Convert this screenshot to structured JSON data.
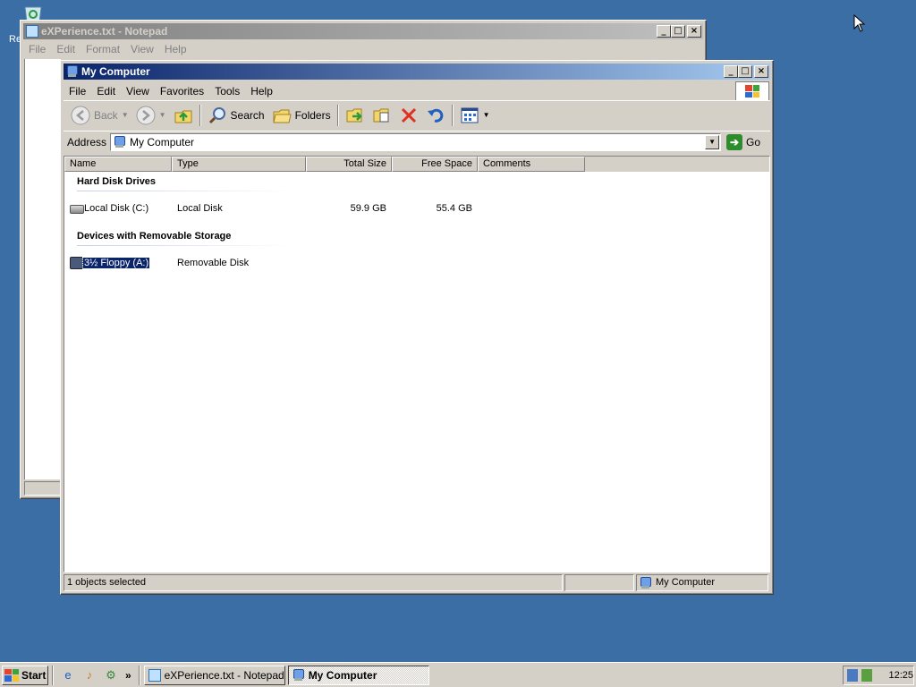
{
  "desktop": {
    "recycle_bin_label": "Re"
  },
  "notepad": {
    "title": "eXPerience.txt - Notepad",
    "menu": [
      "File",
      "Edit",
      "Format",
      "View",
      "Help"
    ]
  },
  "explorer": {
    "title": "My Computer",
    "menu": [
      "File",
      "Edit",
      "View",
      "Favorites",
      "Tools",
      "Help"
    ],
    "toolbar": {
      "back": "Back",
      "search": "Search",
      "folders": "Folders"
    },
    "address": {
      "label": "Address",
      "value": "My Computer",
      "go": "Go"
    },
    "columns": [
      "Name",
      "Type",
      "Total Size",
      "Free Space",
      "Comments"
    ],
    "groups": [
      {
        "header": "Hard Disk Drives",
        "items": [
          {
            "name": "Local Disk (C:)",
            "type": "Local Disk",
            "total": "59.9 GB",
            "free": "55.4 GB",
            "icon": "hard-disk-icon",
            "selected": false
          }
        ]
      },
      {
        "header": "Devices with Removable Storage",
        "items": [
          {
            "name": "3½ Floppy (A:)",
            "type": "Removable Disk",
            "total": "",
            "free": "",
            "icon": "floppy-icon",
            "selected": true
          }
        ]
      }
    ],
    "status": {
      "selection": "1 objects selected",
      "location": "My Computer"
    }
  },
  "taskbar": {
    "start": "Start",
    "tasks": [
      {
        "label": "eXPerience.txt - Notepad",
        "active": false
      },
      {
        "label": "My Computer",
        "active": true
      }
    ],
    "clock": "12:25"
  }
}
